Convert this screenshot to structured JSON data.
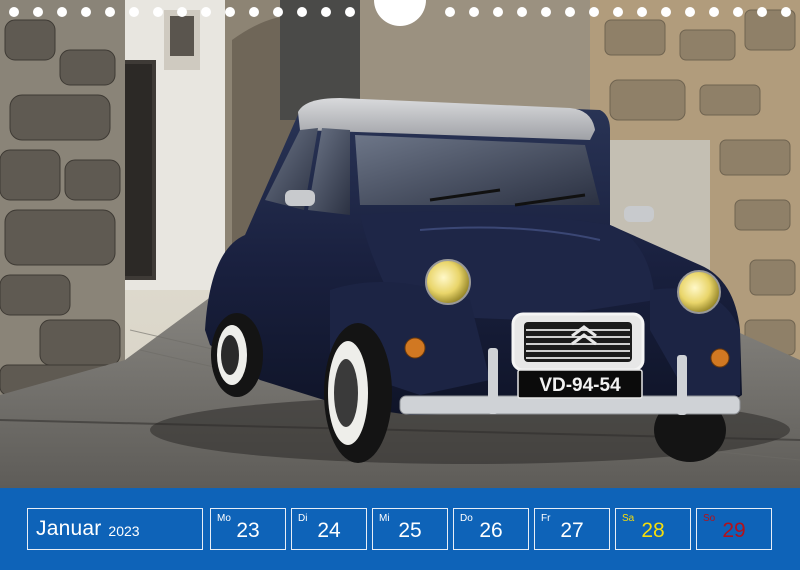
{
  "photo": {
    "subject": "car-photo",
    "license_plate": "VD-94-54"
  },
  "calendar": {
    "month": "Januar",
    "year": "2023",
    "days": [
      {
        "abbr": "Mo",
        "num": "23"
      },
      {
        "abbr": "Di",
        "num": "24"
      },
      {
        "abbr": "Mi",
        "num": "25"
      },
      {
        "abbr": "Do",
        "num": "26"
      },
      {
        "abbr": "Fr",
        "num": "27"
      },
      {
        "abbr": "Sa",
        "num": "28"
      },
      {
        "abbr": "So",
        "num": "29"
      }
    ]
  },
  "colors": {
    "bar": "#0e63b8",
    "saturday": "#f5dd0b",
    "sunday": "#b3121b",
    "weekday": "#ffffff"
  }
}
